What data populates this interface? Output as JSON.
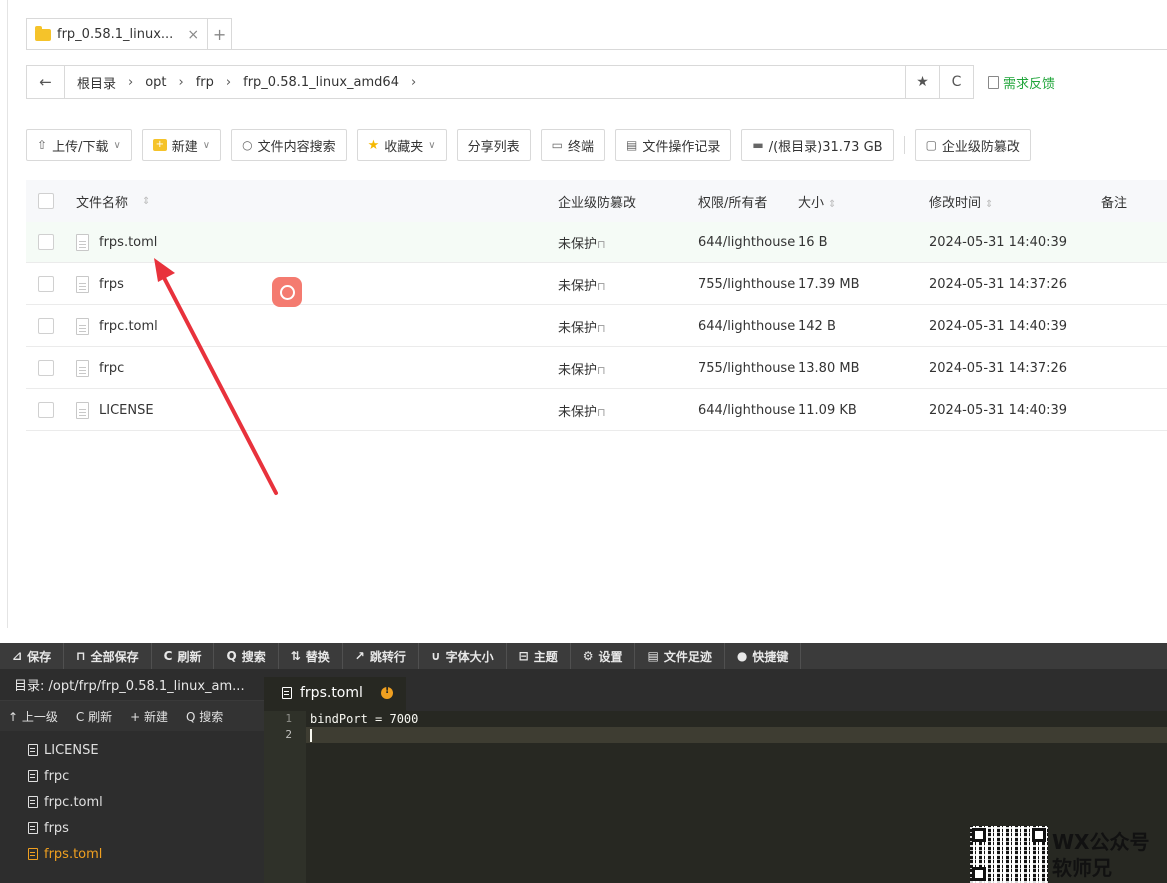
{
  "tab": {
    "title": "frp_0.58.1_linux...",
    "close": "×",
    "add": "+"
  },
  "address": {
    "back": "←",
    "crumbs": [
      "根目录",
      "opt",
      "frp",
      "frp_0.58.1_linux_amd64"
    ],
    "sep": "›",
    "star": "★",
    "refresh": "C",
    "feedback": "需求反馈"
  },
  "toolbar": {
    "upload": "上传/下载",
    "new": "新建",
    "search": "文件内容搜索",
    "favorites": "收藏夹",
    "share": "分享列表",
    "terminal": "终端",
    "oplog": "文件操作记录",
    "disk": "/(根目录)31.73 GB",
    "tamper": "企业级防篡改"
  },
  "table": {
    "headers": {
      "name": "文件名称",
      "protect": "企业级防篡改",
      "perm": "权限/所有者",
      "size": "大小",
      "mtime": "修改时间",
      "note": "备注"
    },
    "rows": [
      {
        "name": "frps.toml",
        "protect": "未保护",
        "perm": "644/lighthouse",
        "size": "16 B",
        "mtime": "2024-05-31 14:40:39"
      },
      {
        "name": "frps",
        "protect": "未保护",
        "perm": "755/lighthouse",
        "size": "17.39 MB",
        "mtime": "2024-05-31 14:37:26"
      },
      {
        "name": "frpc.toml",
        "protect": "未保护",
        "perm": "644/lighthouse",
        "size": "142 B",
        "mtime": "2024-05-31 14:40:39"
      },
      {
        "name": "frpc",
        "protect": "未保护",
        "perm": "755/lighthouse",
        "size": "13.80 MB",
        "mtime": "2024-05-31 14:37:26"
      },
      {
        "name": "LICENSE",
        "protect": "未保护",
        "perm": "644/lighthouse",
        "size": "11.09 KB",
        "mtime": "2024-05-31 14:40:39"
      }
    ]
  },
  "editor": {
    "toolbar": [
      "保存",
      "全部保存",
      "刷新",
      "搜索",
      "替换",
      "跳转行",
      "字体大小",
      "主题",
      "设置",
      "文件足迹",
      "快捷键"
    ],
    "dir": "目录: /opt/frp/frp_0.58.1_linux_am...",
    "side_tools": [
      "↑ 上一级",
      "C 刷新",
      "+ 新建",
      "Q 搜索"
    ],
    "files": [
      "LICENSE",
      "frpc",
      "frpc.toml",
      "frps",
      "frps.toml"
    ],
    "active_tab": "frps.toml",
    "lines": [
      "bindPort = 7000",
      ""
    ],
    "line_numbers": [
      "1",
      "2"
    ]
  },
  "watermark": {
    "line1": "WX公众号",
    "line2": "软师兄"
  },
  "colors": {
    "accent": "#20a53a",
    "arrow": "#e8323c",
    "editor_bg": "#272822",
    "active_file": "#f0a020"
  }
}
